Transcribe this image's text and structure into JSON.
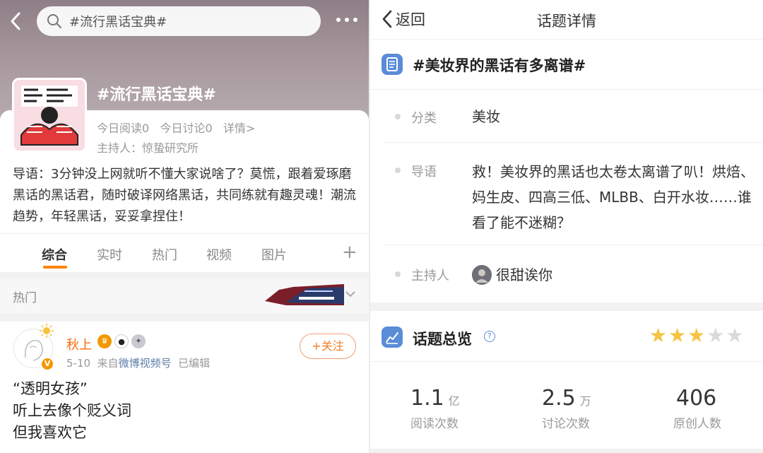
{
  "left": {
    "search_query": "#流行黑话宝典#",
    "topic_title": "#流行黑话宝典#",
    "stats": {
      "today_read": "今日阅读0",
      "today_discuss": "今日讨论0",
      "details_link": "详情>"
    },
    "host": "主持人：惊蛰研究所",
    "intro": "导语：3分钟没上网就听不懂大家说啥了？莫慌，跟着爱琢磨黑话的黑话君，随时破译网络黑话，共同练就有趣灵魂！潮流趋势，年轻黑话，妥妥拿捏住！",
    "tabs": [
      "综合",
      "实时",
      "热门",
      "视频",
      "图片"
    ],
    "active_tab": 0,
    "hot_label": "热门",
    "post": {
      "username": "秋上",
      "date": "5-10",
      "source_prefix": "来自",
      "source": "微博视频号",
      "edited": "已编辑",
      "follow_label": "+关注",
      "lines": [
        "“透明女孩”",
        "听上去像个贬义词",
        "但我喜欢它"
      ]
    }
  },
  "right": {
    "back_label": "返回",
    "nav_title": "话题详情",
    "topic_name": "#美妆界的黑话有多离谱#",
    "category_key": "分类",
    "category_value": "美妆",
    "guide_key": "导语",
    "guide_value": "救！美妆界的黑话也太卷太离谱了叭！烘焙、妈生皮、四高三低、MLBB、白开水妆……谁看了能不迷糊？",
    "host_key": "主持人",
    "host_name": "很甜诶你",
    "overview_title": "话题总览",
    "rating": 3,
    "rating_max": 5,
    "stats": [
      {
        "value": "1.1",
        "unit": "亿",
        "label": "阅读次数"
      },
      {
        "value": "2.5",
        "unit": "万",
        "label": "讨论次数"
      },
      {
        "value": "406",
        "unit": "",
        "label": "原创人数"
      }
    ]
  },
  "colors": {
    "accent": "#ff8200",
    "username": "#f86b0f",
    "icon_blue": "#5a8cd8",
    "star_on": "#f5c342",
    "star_off": "#d9d9d9"
  }
}
